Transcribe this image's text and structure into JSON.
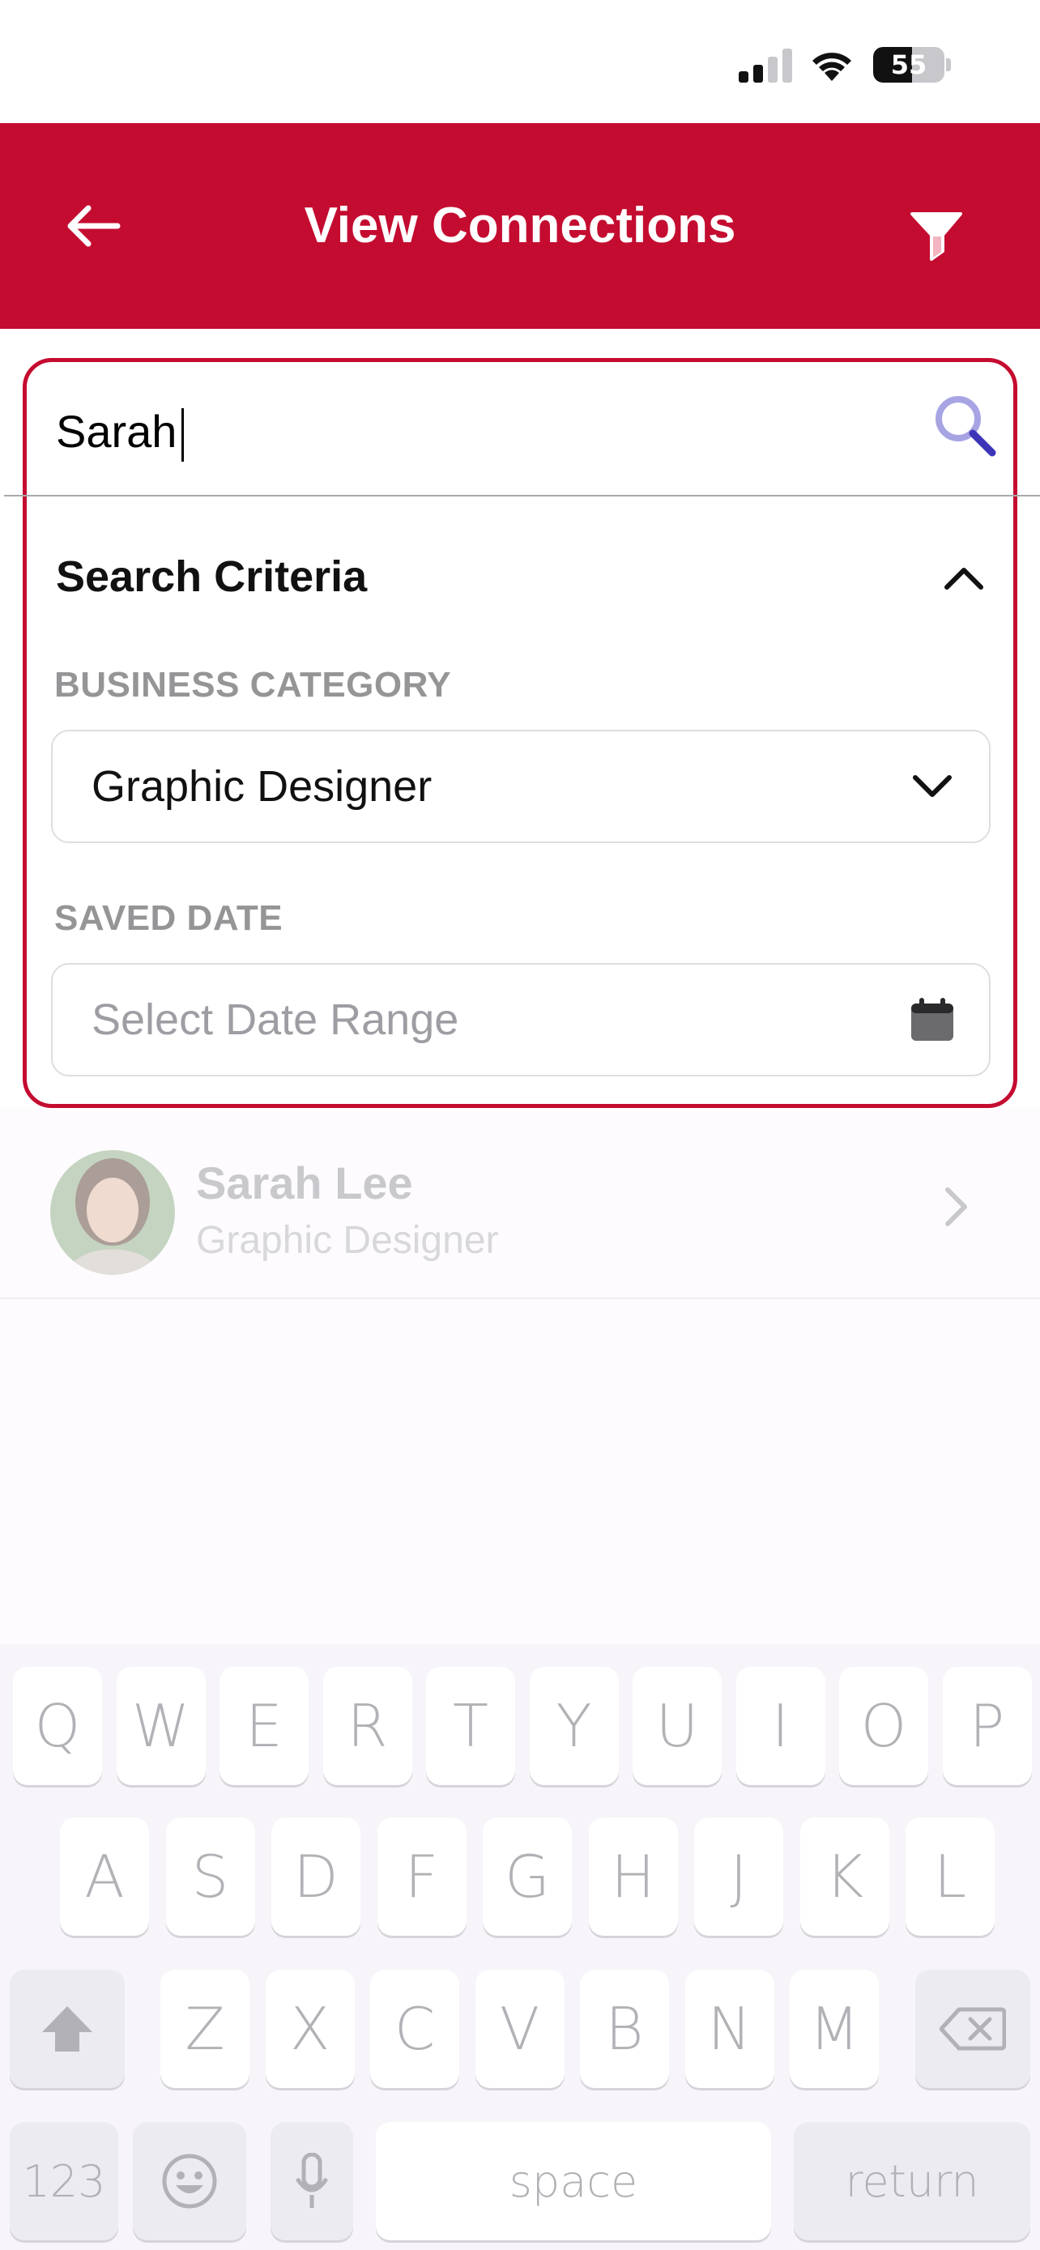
{
  "status_bar": {
    "battery_level": "55",
    "battery_fraction": 0.55
  },
  "header": {
    "title": "View Connections",
    "back_icon": "arrow-left-icon",
    "filter_icon": "filter-icon",
    "background_color": "#c40c30"
  },
  "search": {
    "value": "Sarah",
    "icon": "search-icon"
  },
  "criteria": {
    "title": "Search Criteria",
    "toggle_icon": "chevron-up-icon",
    "business_category": {
      "label": "BUSINESS CATEGORY",
      "selected": "Graphic Designer",
      "icon": "chevron-down-icon"
    },
    "saved_date": {
      "label": "SAVED DATE",
      "placeholder": "Select Date Range",
      "icon": "calendar-icon"
    }
  },
  "results": [
    {
      "name": "Sarah Lee",
      "subtitle": "Graphic Designer",
      "icon": "chevron-right-icon"
    }
  ],
  "keyboard": {
    "row1": [
      "Q",
      "W",
      "E",
      "R",
      "T",
      "Y",
      "U",
      "I",
      "O",
      "P"
    ],
    "row2": [
      "A",
      "S",
      "D",
      "F",
      "G",
      "H",
      "J",
      "K",
      "L"
    ],
    "row3": [
      "Z",
      "X",
      "C",
      "V",
      "B",
      "N",
      "M"
    ],
    "numbers_label": "123",
    "space_label": "space",
    "return_label": "return",
    "shift_icon": "shift-icon",
    "delete_icon": "delete-icon",
    "emoji_icon": "emoji-icon",
    "mic_icon": "microphone-icon"
  }
}
